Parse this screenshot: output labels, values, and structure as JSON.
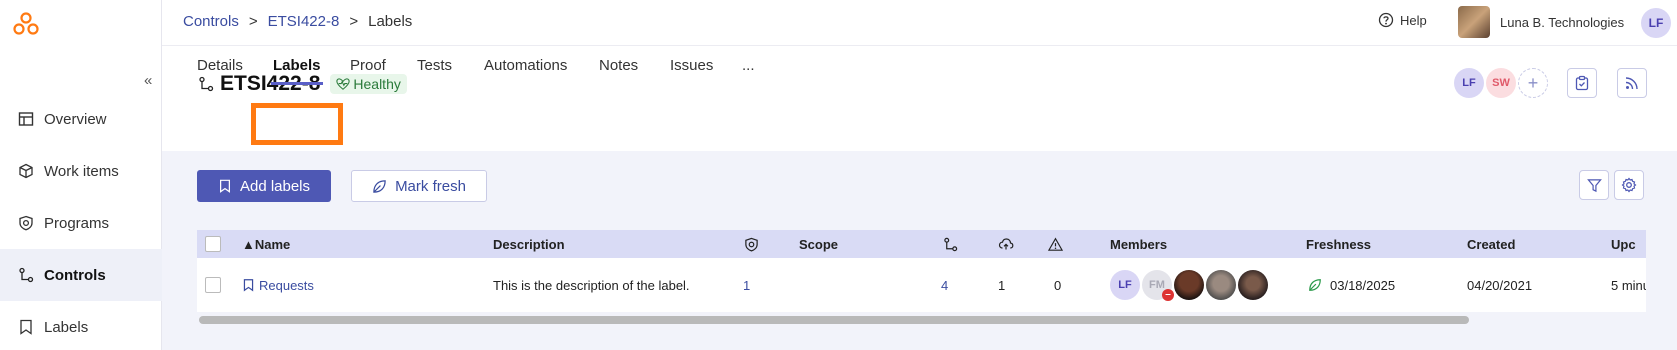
{
  "breadcrumb": [
    "Controls",
    "ETSI422-8",
    "Labels"
  ],
  "topbar": {
    "help": "Help",
    "org_name": "Luna B. Technologies",
    "user_initials": "LF"
  },
  "sidebar": {
    "items": [
      {
        "label": "Overview",
        "icon": "overview-icon"
      },
      {
        "label": "Work items",
        "icon": "box-icon"
      },
      {
        "label": "Programs",
        "icon": "shield-icon"
      },
      {
        "label": "Controls",
        "icon": "controls-icon",
        "active": true
      },
      {
        "label": "Labels",
        "icon": "bookmark-icon"
      }
    ]
  },
  "header": {
    "title": "ETSI422-8",
    "health": "Healthy",
    "avatars": [
      "LF",
      "SW"
    ],
    "tabs": [
      "Details",
      "Labels",
      "Proof",
      "Tests",
      "Automations",
      "Notes",
      "Issues",
      "..."
    ],
    "active_tab": "Labels"
  },
  "actions": {
    "add_labels": "Add labels",
    "mark_fresh": "Mark fresh"
  },
  "table": {
    "columns": [
      "▲Name",
      "Description",
      "Scope",
      "Members",
      "Freshness",
      "Created",
      "Upc"
    ],
    "row": {
      "name": "Requests",
      "description": "This is the description of the label.",
      "programs": "1",
      "controls": "4",
      "automations": "1",
      "issues": "0",
      "members": [
        "LF",
        "FM"
      ],
      "freshness": "03/18/2025",
      "created": "04/20/2021",
      "updated": "5 minu"
    }
  },
  "colors": {
    "accent": "#4e58b4",
    "highlight": "#ff7a12",
    "healthy": "#2a7a3a"
  }
}
